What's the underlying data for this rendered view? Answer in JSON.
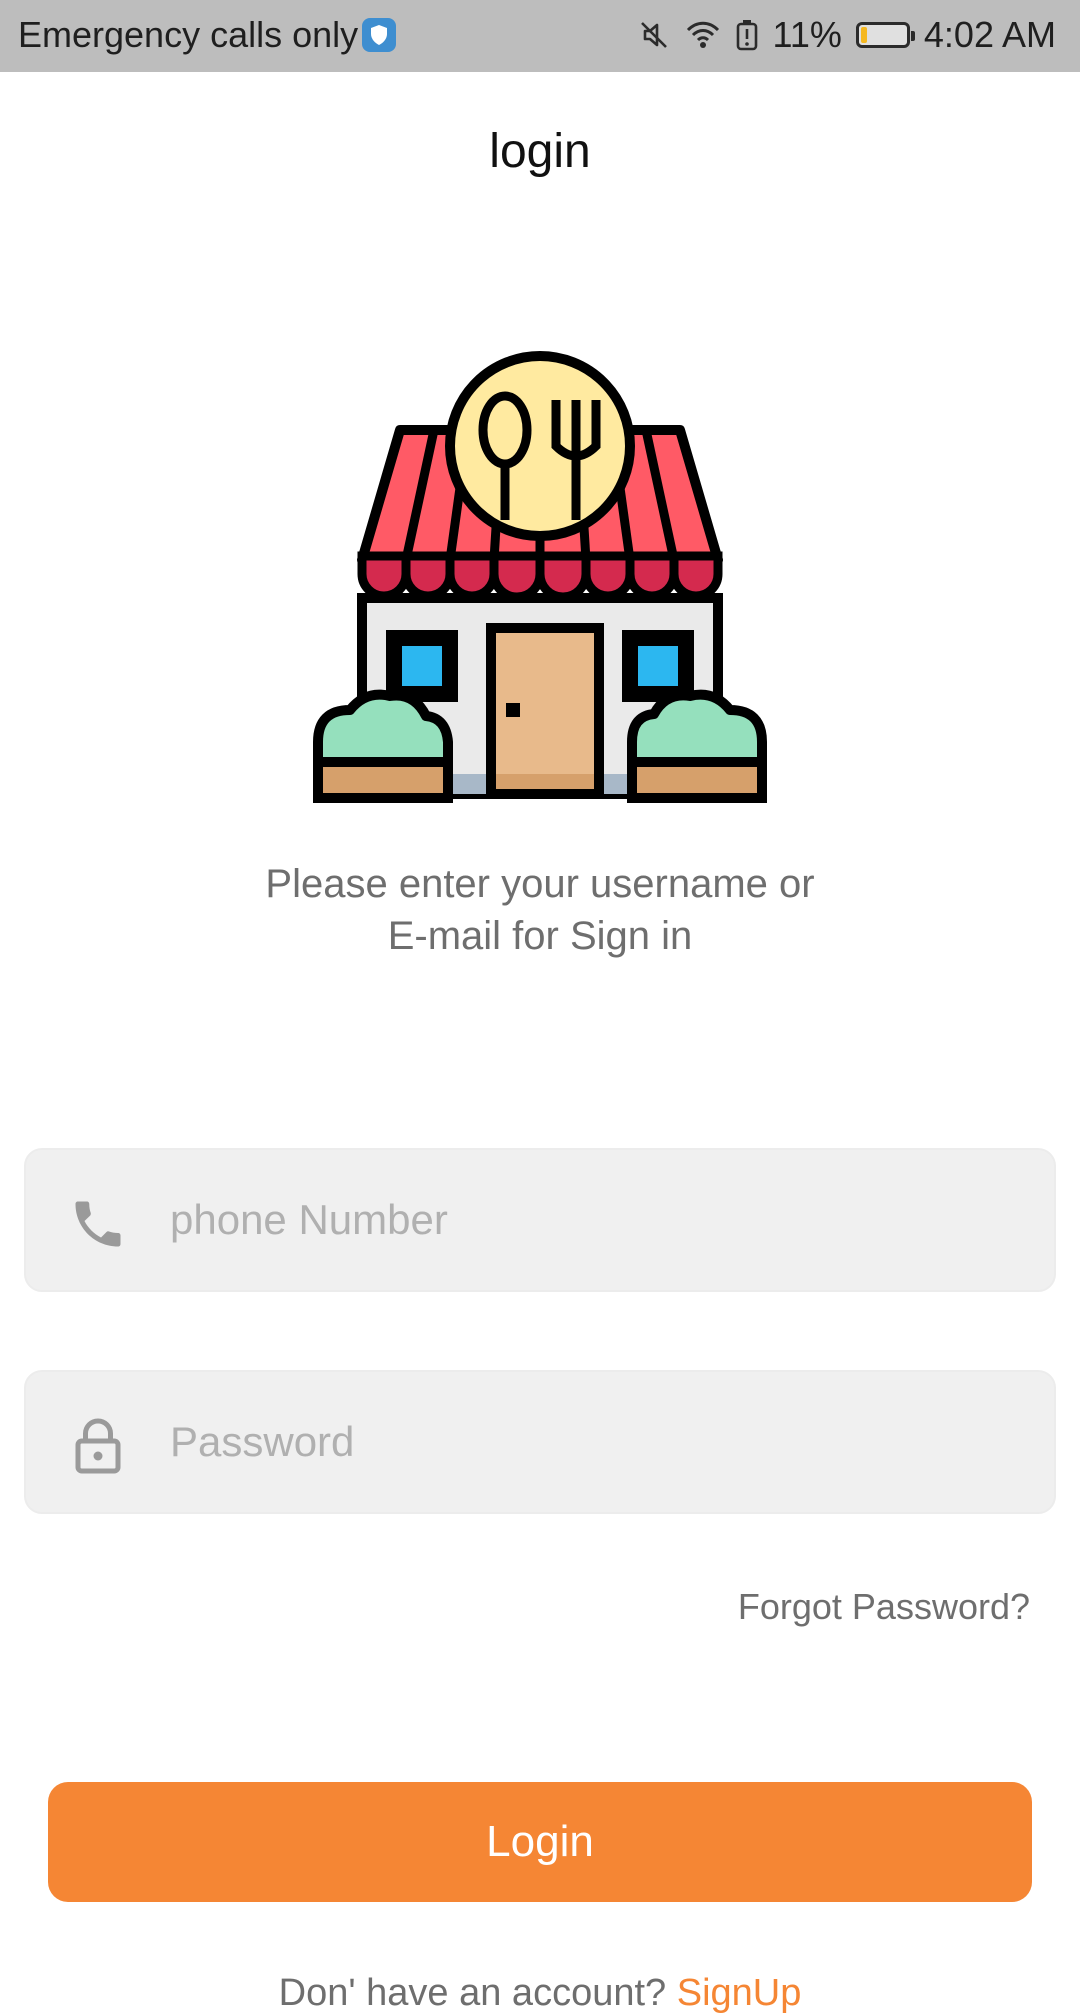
{
  "status_bar": {
    "carrier_text": "Emergency calls only",
    "battery_percent": "11%",
    "battery_level": 0.11,
    "time": "4:02 AM",
    "icons": [
      "shield-icon",
      "mute-icon",
      "wifi-icon",
      "battery-alert-icon",
      "battery-icon"
    ]
  },
  "header": {
    "title": "login"
  },
  "illustration": {
    "icon": "restaurant-storefront-icon"
  },
  "intro": {
    "line1": "Please enter your username or",
    "line2": "E-mail for Sign in"
  },
  "form": {
    "phone": {
      "icon": "phone-icon",
      "placeholder": "phone Number",
      "value": ""
    },
    "password": {
      "icon": "lock-icon",
      "placeholder": "Password",
      "value": ""
    },
    "forgot_label": "Forgot Password?",
    "login_label": "Login"
  },
  "footer": {
    "prompt": "Don' have an account?",
    "signup_label": "SignUp"
  },
  "colors": {
    "accent": "#f58634",
    "field_bg": "#f0f0f0",
    "status_bar_bg": "#bdbdbd",
    "muted_text": "#6e6e6e"
  }
}
